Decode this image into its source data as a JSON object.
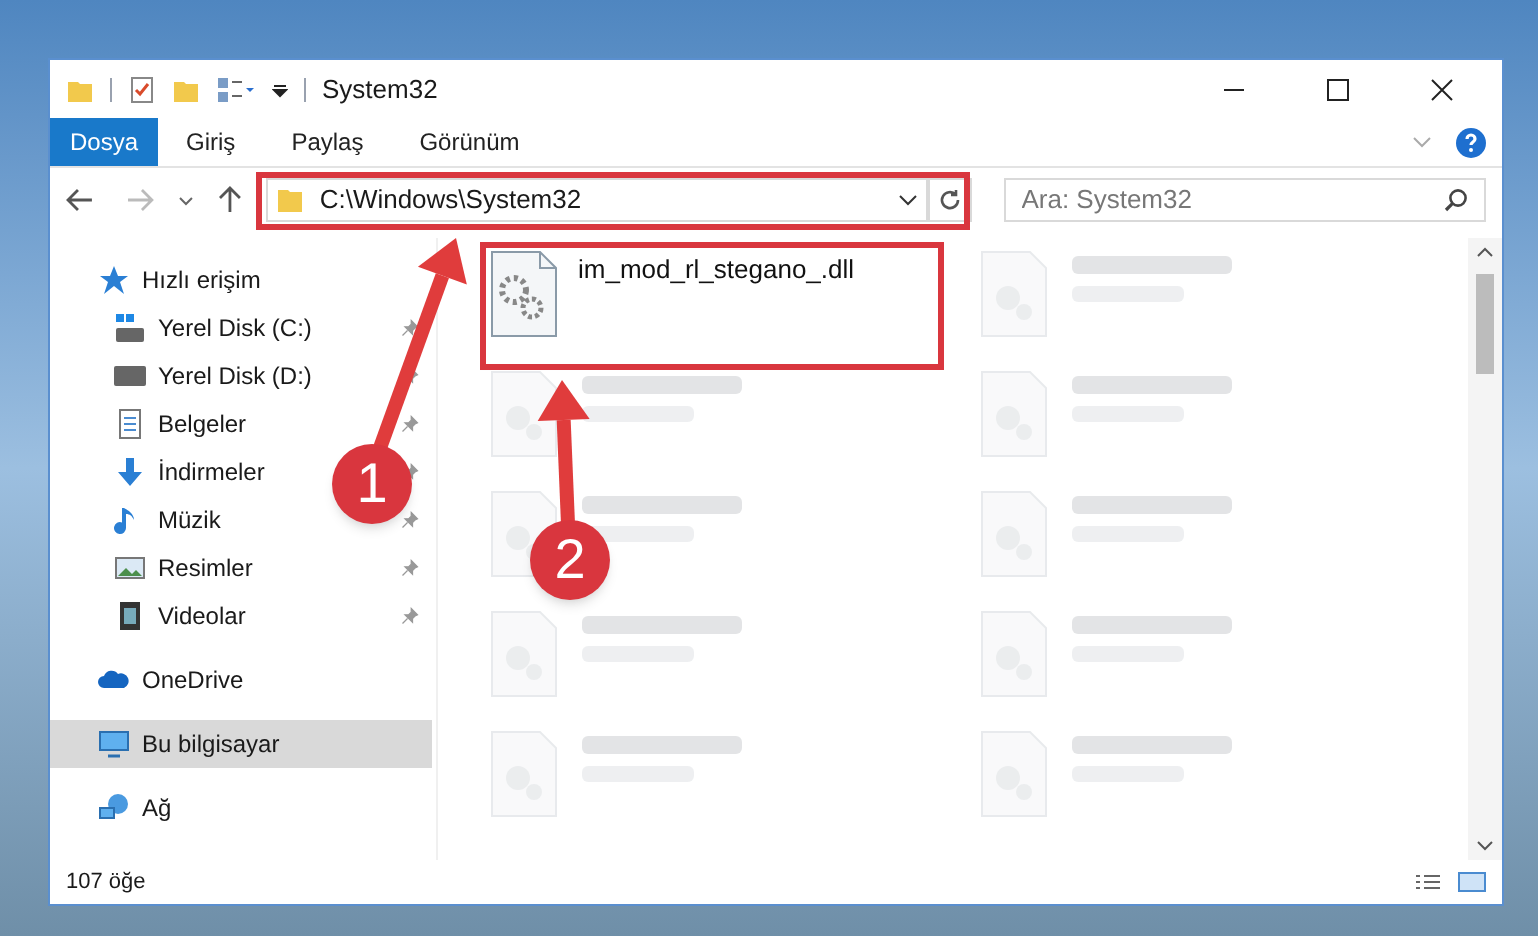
{
  "window": {
    "title": "System32"
  },
  "ribbon_tabs": [
    {
      "label": "Dosya",
      "selected": true
    },
    {
      "label": "Giriş",
      "selected": false
    },
    {
      "label": "Paylaş",
      "selected": false
    },
    {
      "label": "Görünüm",
      "selected": false
    }
  ],
  "address": {
    "path": "C:\\Windows\\System32"
  },
  "search": {
    "placeholder": "Ara: System32"
  },
  "navigation": [
    {
      "label": "Hızlı erişim",
      "selected": false,
      "children": [
        {
          "label": "Yerel Disk (C:)",
          "pinned": true
        },
        {
          "label": "Yerel Disk (D:)",
          "pinned": true
        },
        {
          "label": "Belgeler",
          "pinned": true
        },
        {
          "label": "İndirmeler",
          "pinned": true
        },
        {
          "label": "Müzik",
          "pinned": true
        },
        {
          "label": "Resimler",
          "pinned": true
        },
        {
          "label": "Videolar",
          "pinned": true
        }
      ]
    },
    {
      "label": "OneDrive",
      "selected": false
    },
    {
      "label": "Bu bilgisayar",
      "selected": true
    },
    {
      "label": "Ağ",
      "selected": false
    }
  ],
  "files": [
    {
      "kind": "file",
      "name": "im_mod_rl_stegano_.dll"
    },
    {
      "kind": "blurred"
    },
    {
      "kind": "blurred"
    },
    {
      "kind": "blurred"
    },
    {
      "kind": "blurred"
    },
    {
      "kind": "blurred"
    },
    {
      "kind": "blurred"
    },
    {
      "kind": "blurred"
    },
    {
      "kind": "blurred"
    },
    {
      "kind": "blurred"
    }
  ],
  "status_bar": {
    "item_count": "107 öğe"
  },
  "annotations": [
    {
      "label": "1"
    },
    {
      "label": "2"
    }
  ]
}
